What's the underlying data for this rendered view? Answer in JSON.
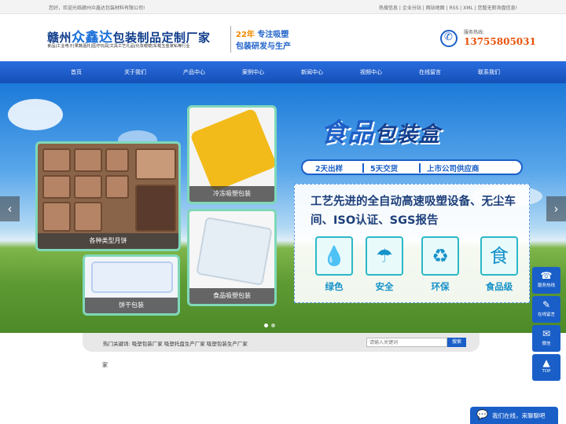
{
  "topbar": {
    "welcome": "您好，欢迎光临赣州众鑫达包装材料有限公司!",
    "links": "热搜信息 | 企业分站 | 网站地图 | RSS | XML | 您暂无新询盘信息!"
  },
  "header": {
    "company_prefix": "赣州",
    "company_brand": "众鑫达",
    "company_suffix": "包装制品定制厂家",
    "tagline": "食品|工业电子|果蔬酒托|医疗玩具|文具工艺礼品|化妆眼镜|车载五金家私等行业",
    "slogan_years": "22年",
    "slogan_line1": "专注吸塑",
    "slogan_line2": "包装研发与生产",
    "phone_label": "服务热线:",
    "phone_number": "13755805031"
  },
  "nav": {
    "items": [
      "首页",
      "关于我们",
      "产品中心",
      "案例中心",
      "新闻中心",
      "视频中心",
      "在线留言",
      "联系我们"
    ]
  },
  "banner": {
    "title_part1": "食品",
    "title_part2": "包装盒",
    "badges": [
      "2天出样",
      "5天交货",
      "上市公司供应商"
    ],
    "info_text": "工艺先进的全自动高速吸塑设备、无尘车间、ISO认证、SGS报告",
    "features": [
      {
        "label": "绿色",
        "icon": "water-drop-icon"
      },
      {
        "label": "安全",
        "icon": "umbrella-icon"
      },
      {
        "label": "环保",
        "icon": "recycle-icon"
      },
      {
        "label": "食品级",
        "icon": "food-icon"
      }
    ],
    "products": {
      "mooncake": "各种类型月饼",
      "frozen": "冷冻吸塑包装",
      "food": "食品吸塑包装",
      "biscuit": "饼干包装"
    },
    "prev_arrow": "‹",
    "next_arrow": "›"
  },
  "search": {
    "keywords_label": "热门关键词: 吸塑包装厂家  吸塑托盘生产厂家  吸塑包装生产厂家",
    "placeholder": "请输入关键词",
    "button": "搜索"
  },
  "stray_text": "家",
  "floating": {
    "hotline": "服务热线",
    "message": "在线留言",
    "wechat": "微信",
    "top": "TOP"
  },
  "chat": {
    "label": "我们在线，来聊聊吧"
  },
  "colors": {
    "brand_blue": "#1a5fc8",
    "phone_orange": "#e8520a",
    "feature_teal": "#1592c9"
  }
}
